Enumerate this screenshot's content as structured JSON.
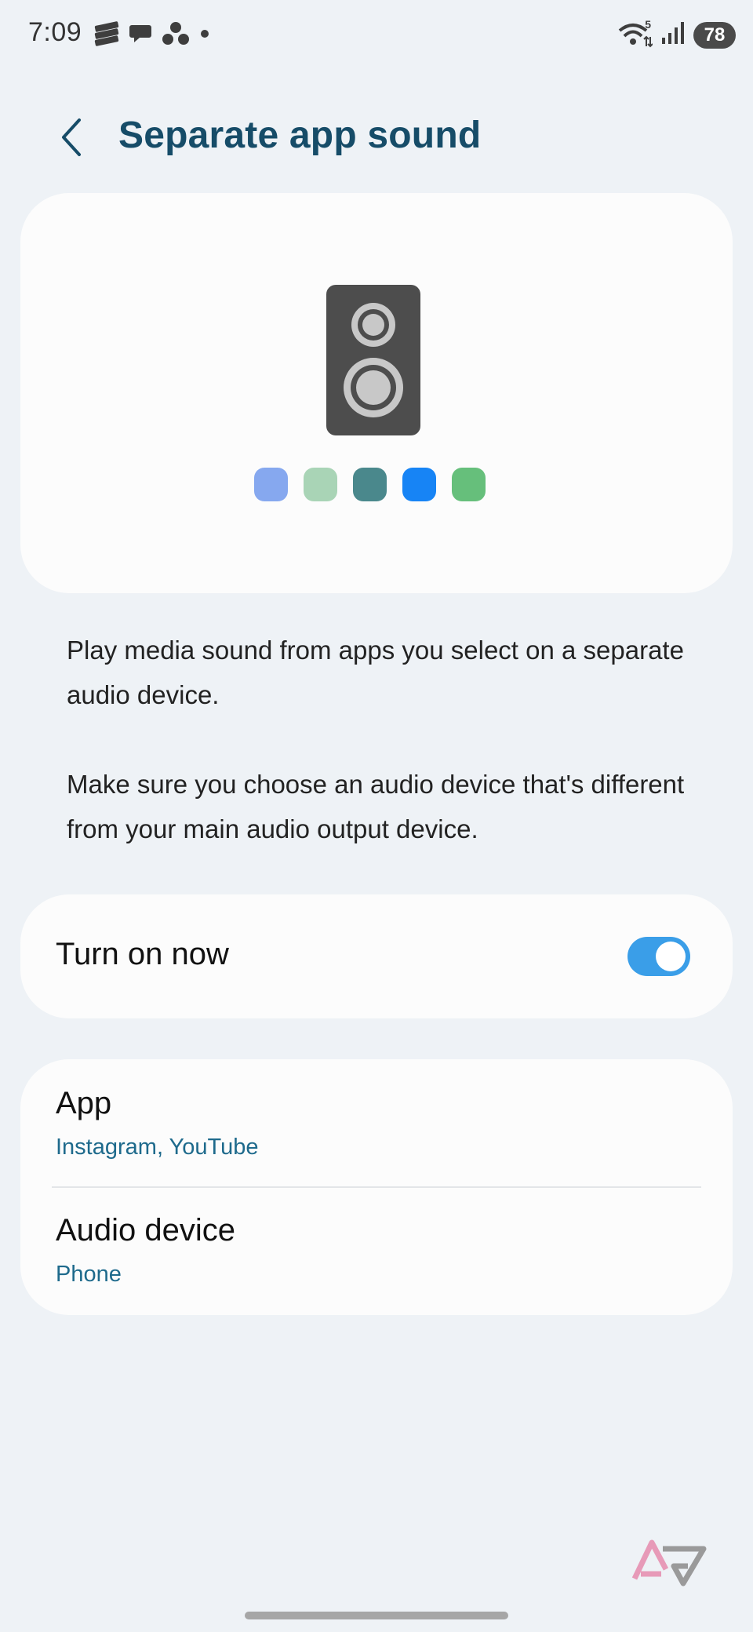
{
  "status_bar": {
    "time": "7:09",
    "battery": "78",
    "left_icons": [
      "stack-icon",
      "chat-icon",
      "group-icon",
      "dot-icon"
    ],
    "right_icons": [
      "wifi-icon",
      "signal-icon"
    ],
    "wifi_badge": "5"
  },
  "header": {
    "title": "Separate app sound",
    "back_icon": "chevron-left-icon"
  },
  "illustration": {
    "icon": "speaker-icon",
    "dot_colors": [
      "#86a8ef",
      "#a9d4b6",
      "#4a888c",
      "#1784f5",
      "#66bf7b"
    ]
  },
  "description": {
    "paragraph1": "Play media sound from apps you select on a separate audio device.",
    "paragraph2": "Make sure you choose an audio device that's different from your main audio output device."
  },
  "toggle": {
    "label": "Turn on now",
    "state": "on",
    "accent": "#3a9ee8"
  },
  "settings": {
    "items": [
      {
        "title": "App",
        "subtitle": "Instagram, YouTube"
      },
      {
        "title": "Audio device",
        "subtitle": "Phone"
      }
    ]
  },
  "colors": {
    "background": "#eef2f6",
    "card": "#fcfcfc",
    "title": "#164c68",
    "subtitle": "#1e6a8c"
  },
  "watermark": {
    "icon": "ap-logo-icon"
  }
}
